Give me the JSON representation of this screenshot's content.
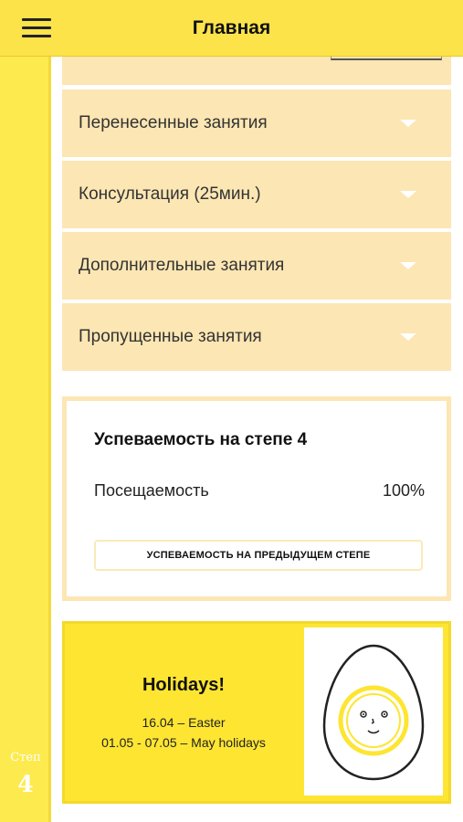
{
  "header": {
    "title": "Главная",
    "menu_icon": "hamburger-icon"
  },
  "sidebar": {
    "step_label": "Степ",
    "step_number": "4"
  },
  "accordion": {
    "items": [
      {
        "label": "Перенесенные занятия",
        "icon": "chevron-down-icon"
      },
      {
        "label": "Консультация (25мин.)",
        "icon": "chevron-down-icon"
      },
      {
        "label": "Дополнительные занятия",
        "icon": "chevron-down-icon"
      },
      {
        "label": "Пропущенные занятия",
        "icon": "chevron-down-icon"
      }
    ]
  },
  "progress": {
    "title": "Успеваемость на степе 4",
    "attendance_label": "Посещаемость",
    "attendance_value": "100%",
    "previous_button": "УСПЕВАЕМОСТЬ НА ПРЕДЫДУЩЕМ СТЕПЕ"
  },
  "holidays": {
    "title": "Holidays!",
    "lines": [
      "16.04 – Easter",
      "01.05 - 07.05 – May holidays"
    ],
    "illustration": "egg-face-icon"
  },
  "colors": {
    "brand_yellow": "#fde34a",
    "accordion_bg": "#fce6b3",
    "holiday_bg": "#fde532"
  }
}
